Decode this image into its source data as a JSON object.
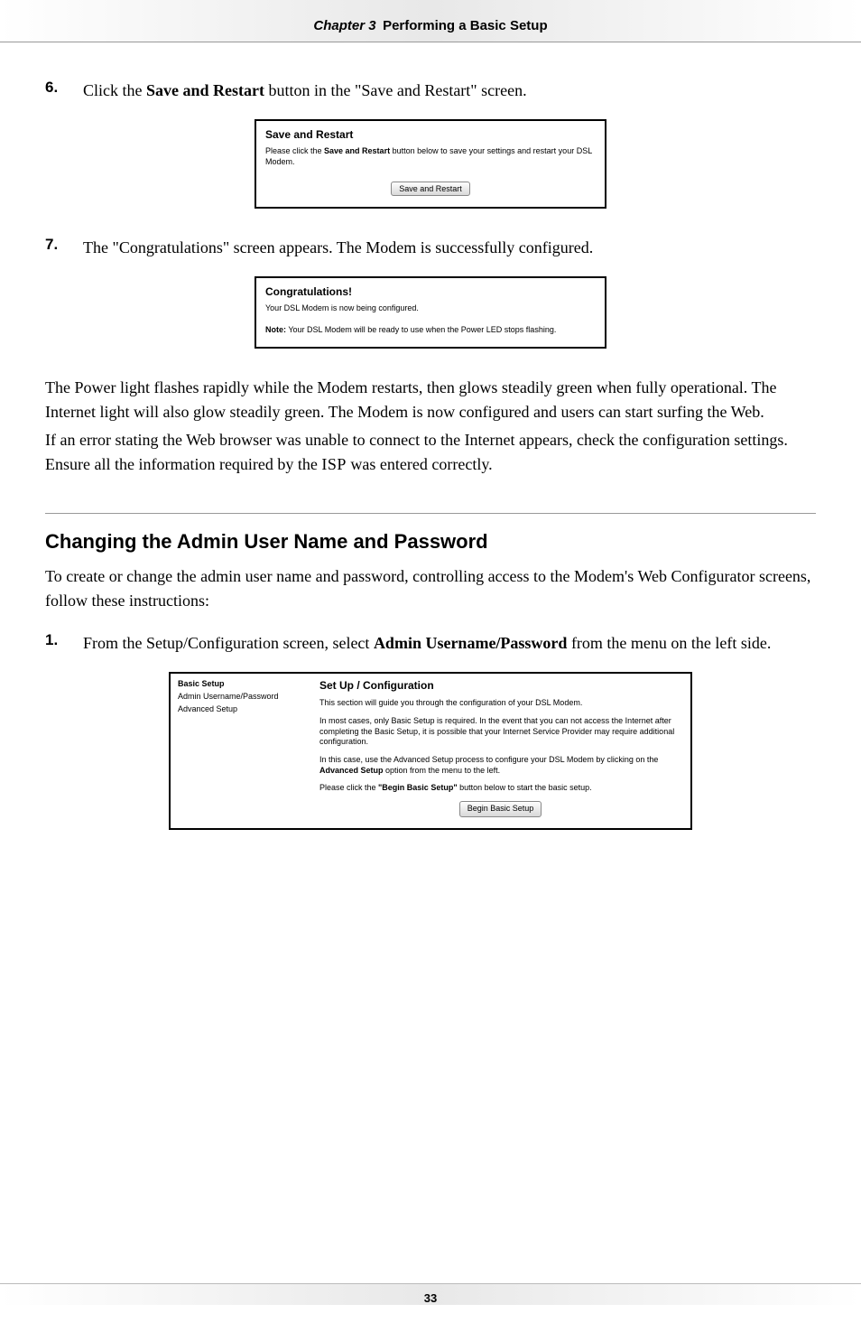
{
  "header": {
    "chapter_label": "Chapter 3",
    "chapter_title": "Performing a Basic Setup"
  },
  "step6": {
    "num": "6.",
    "pre": "Click the ",
    "bold": "Save and Restart",
    "post": " button in the \"Save and Restart\" screen."
  },
  "shot1": {
    "title": "Save and Restart",
    "desc_pre": "Please click the ",
    "desc_bold": "Save and Restart",
    "desc_post": " button below to save your settings and restart your DSL Modem.",
    "button": "Save and Restart"
  },
  "step7": {
    "num": "7.",
    "text": "The \"Congratulations\" screen appears. The Modem is successfully configured."
  },
  "shot2": {
    "title": "Congratulations!",
    "desc": "Your DSL Modem is now being configured.",
    "note_bold": "Note:",
    "note_text": " Your DSL Modem will be ready to use when the Power LED stops flashing."
  },
  "para1": "The Power light flashes rapidly while the Modem restarts, then glows steadily green when fully operational. The Internet light will also glow steadily green. The Modem is now configured and users can start surfing the Web.",
  "para2_pre": "If an error stating the Web browser was unable to connect to the Internet appears, check the configuration settings. Ensure all the information required by the ",
  "para2_isp": "ISP",
  "para2_post": " was entered correctly.",
  "section_heading": "Changing the Admin User Name and Password",
  "para3": "To create or change the admin user name and password, controlling access to the Modem's Web Configurator screens, follow these instructions:",
  "step1": {
    "num": "1.",
    "pre": "From the Setup/Configuration screen, select ",
    "bold": "Admin Username/Password",
    "post": " from the menu on the left side."
  },
  "shot3": {
    "side": {
      "item1": "Basic Setup",
      "item2": "Admin Username/Password",
      "item3": "Advanced Setup"
    },
    "main": {
      "title": "Set Up / Configuration",
      "p1": "This section will guide you through the configuration of your DSL Modem.",
      "p2": "In most cases, only Basic Setup is required. In the event that you can not access the Internet after completing the Basic Setup, it is possible that your Internet Service Provider may require additional configuration.",
      "p3_pre": "In this case, use the Advanced Setup process to configure your DSL Modem by clicking on the ",
      "p3_bold": "Advanced Setup",
      "p3_post": " option from the menu to the left.",
      "p4_pre": "Please click the ",
      "p4_bold": "\"Begin Basic Setup\"",
      "p4_post": " button below to start the basic setup.",
      "button": "Begin Basic Setup"
    }
  },
  "footer": {
    "page": "33"
  }
}
